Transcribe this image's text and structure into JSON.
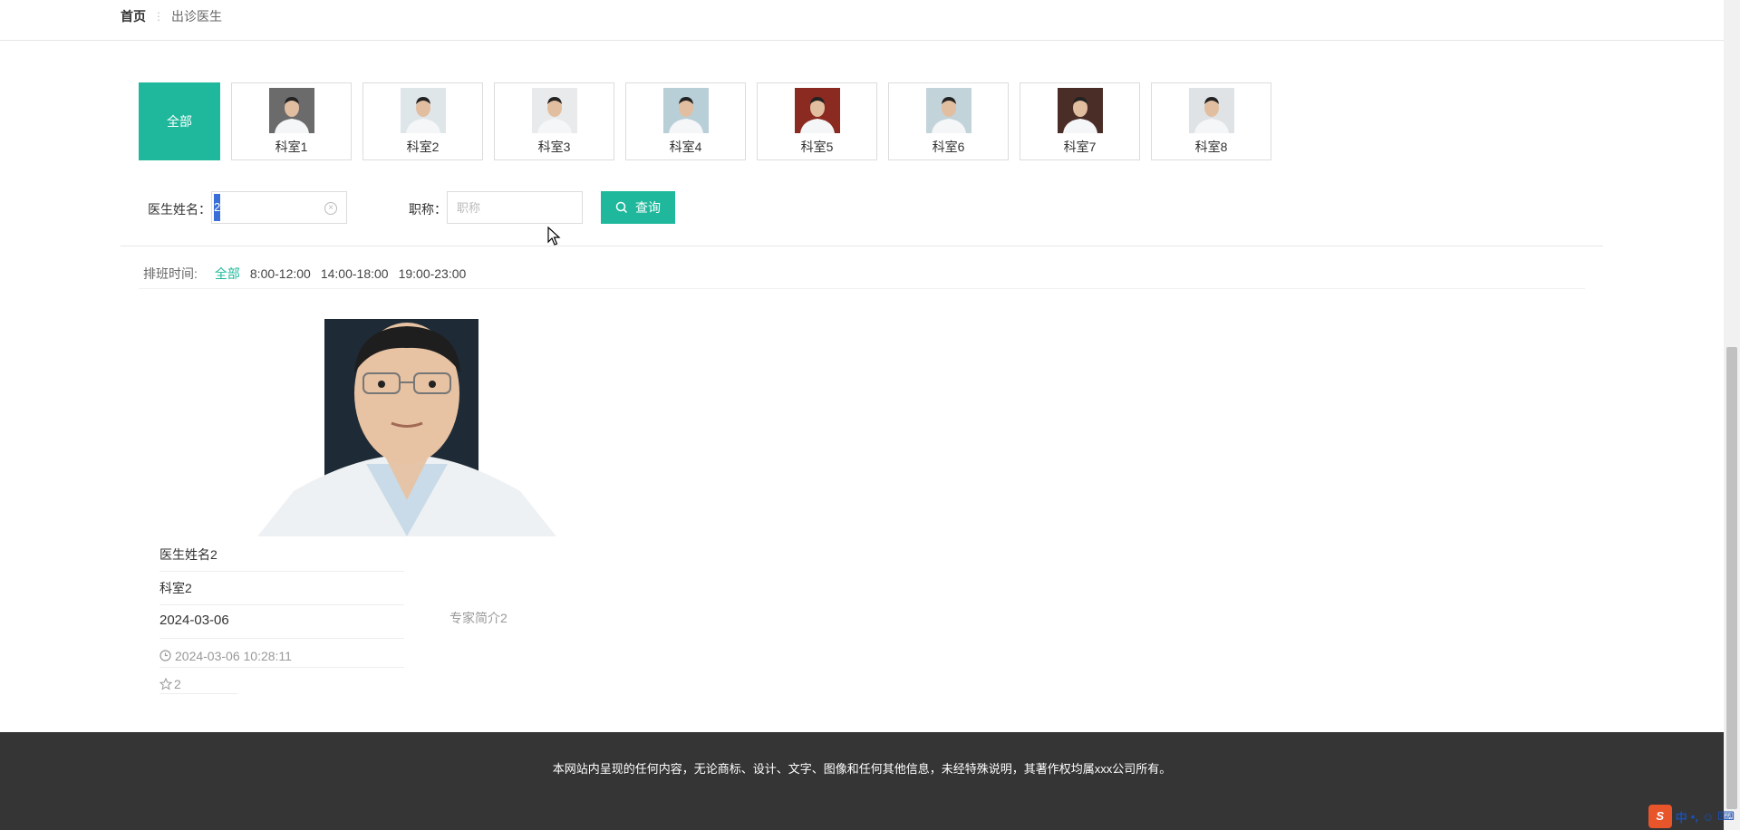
{
  "breadcrumb": {
    "home": "首页",
    "separator": "⋮",
    "current": "出诊医生"
  },
  "departments": {
    "all_label": "全部",
    "items": [
      {
        "label": "科室1",
        "photo_bg": "#6b6b6b"
      },
      {
        "label": "科室2",
        "photo_bg": "#dfe6ea"
      },
      {
        "label": "科室3",
        "photo_bg": "#e8eaec"
      },
      {
        "label": "科室4",
        "photo_bg": "#b9cfd8"
      },
      {
        "label": "科室5",
        "photo_bg": "#8b2a20"
      },
      {
        "label": "科室6",
        "photo_bg": "#c3d3da"
      },
      {
        "label": "科室7",
        "photo_bg": "#4a2d26"
      },
      {
        "label": "科室8",
        "photo_bg": "#dfe3e6"
      }
    ]
  },
  "search": {
    "name_label": "医生姓名：",
    "name_value": "2",
    "title_label": "职称：",
    "title_placeholder": "职称",
    "query_button": "查询"
  },
  "schedule": {
    "label": "排班时间:",
    "options": [
      "全部",
      "8:00-12:00",
      "14:00-18:00",
      "19:00-23:00"
    ],
    "active_index": 0
  },
  "doctor": {
    "name": "医生姓名2",
    "department": "科室2",
    "date": "2024-03-06",
    "created_at": "2024-03-06 10:28:11",
    "favorites": "2",
    "intro": "专家简介2"
  },
  "footer": {
    "copyright": "本网站内呈现的任何内容，无论商标、设计、文字、图像和任何其他信息，未经特殊说明，其著作权均属xxx公司所有。"
  },
  "ime": {
    "logo": "S",
    "mode": "中",
    "punct": "•,",
    "emoji": "☺",
    "keyboard": "⌨"
  },
  "colors": {
    "accent": "#1fb89c",
    "footer_bg": "#353535"
  }
}
